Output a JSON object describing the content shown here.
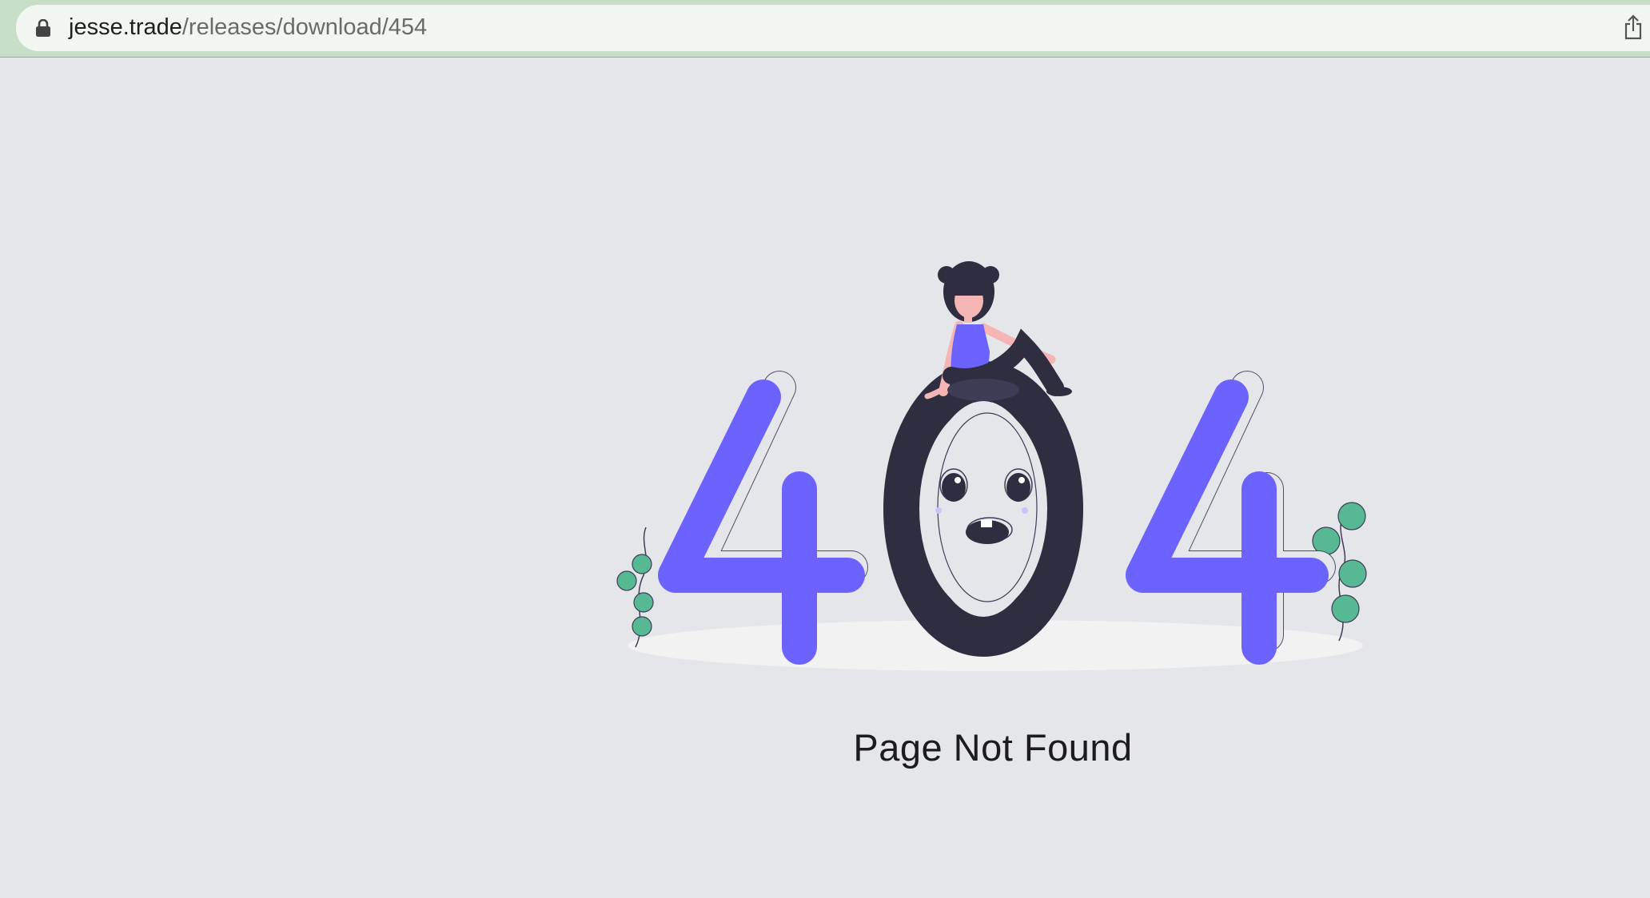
{
  "browser": {
    "url_domain": "jesse.trade",
    "url_path": "/releases/download/454",
    "lock_icon": "lock-icon",
    "share_icon": "share-icon"
  },
  "page": {
    "title": "Page Not Found",
    "illustration": "404-illustration"
  },
  "colors": {
    "accent": "#6c63ff",
    "dark": "#2f2e41",
    "leaf": "#57b894",
    "background": "#e5e6ea"
  }
}
